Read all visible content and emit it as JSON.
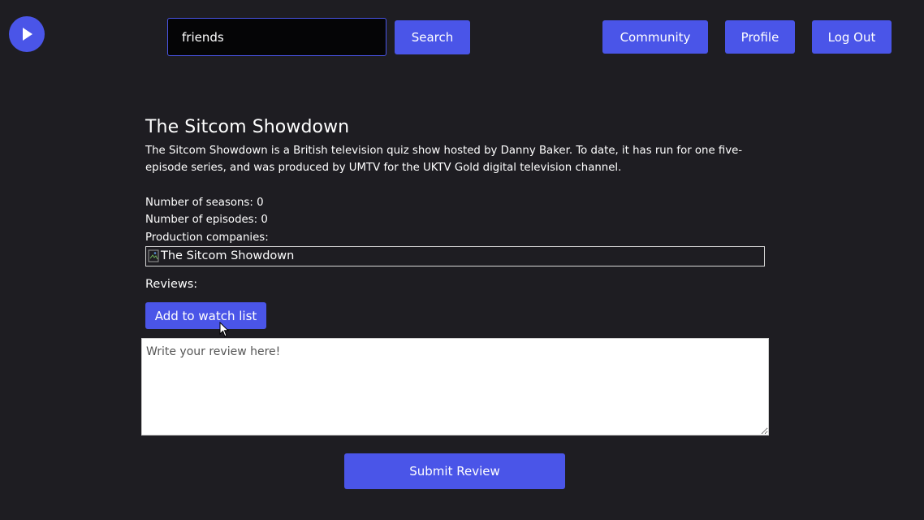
{
  "header": {
    "logo_icon": "play-icon",
    "search": {
      "value": "friends",
      "placeholder": "",
      "button_label": "Search"
    },
    "nav": {
      "community_label": "Community",
      "profile_label": "Profile",
      "logout_label": "Log Out"
    }
  },
  "show": {
    "title": "The Sitcom Showdown",
    "description": "The Sitcom Showdown is a British television quiz show hosted by Danny Baker. To date, it has run for one five-episode series, and was produced by UMTV for the UKTV Gold digital television channel.",
    "seasons_label": "Number of seasons: 0",
    "episodes_label": "Number of episodes: 0",
    "companies_label": "Production companies:",
    "company_image_alt": "The Sitcom Showdown"
  },
  "reviews": {
    "label": "Reviews:",
    "watchlist_button": "Add to watch list",
    "textarea_placeholder": "Write your review here!",
    "submit_button": "Submit Review"
  },
  "colors": {
    "background": "#1e1d22",
    "accent": "#4a55e8"
  }
}
